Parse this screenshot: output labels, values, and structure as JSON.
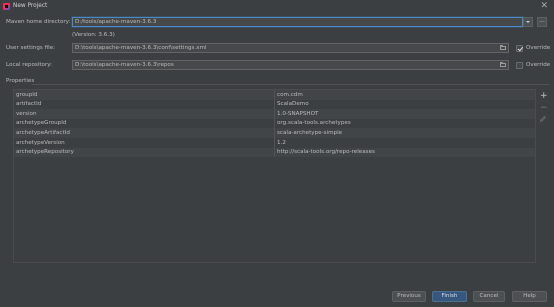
{
  "window": {
    "title": "New Project",
    "close_glyph": "✕",
    "icon": "intellij-app-icon"
  },
  "maven_home": {
    "label": "Maven home directory:",
    "value": "D:/tools/apache-maven-3.6.3",
    "version_text": "(Version: 3.6.3)",
    "browse_label": "..."
  },
  "user_settings": {
    "label": "User settings file:",
    "value": "D:\\tools\\apache-maven-3.6.3\\conf\\settings.xml",
    "override_label": "Override",
    "override_checked": true
  },
  "local_repo": {
    "label": "Local repository:",
    "value": "D:\\tools\\apache-maven-3.6.3\\repos",
    "override_label": "Override",
    "override_checked": false
  },
  "properties": {
    "heading": "Properties",
    "rows": [
      {
        "key": "groupId",
        "value": "com.cdm"
      },
      {
        "key": "artifactId",
        "value": "ScalaDemo"
      },
      {
        "key": "version",
        "value": "1.0-SNAPSHOT"
      },
      {
        "key": "archetypeGroupId",
        "value": "org.scala-tools.archetypes"
      },
      {
        "key": "archetypeArtifactId",
        "value": "scala-archetype-simple"
      },
      {
        "key": "archetypeVersion",
        "value": "1.2"
      },
      {
        "key": "archetypeRepository",
        "value": "http://scala-tools.org/repo-releases"
      }
    ],
    "add_glyph": "+",
    "remove_glyph": "−"
  },
  "buttons": {
    "previous": "Previous",
    "finish": "Finish",
    "cancel": "Cancel",
    "help": "Help"
  },
  "colors": {
    "background": "#3c3f41",
    "field_bg": "#45494a",
    "focus_border": "#4a88c7",
    "default_button": "#365880"
  }
}
